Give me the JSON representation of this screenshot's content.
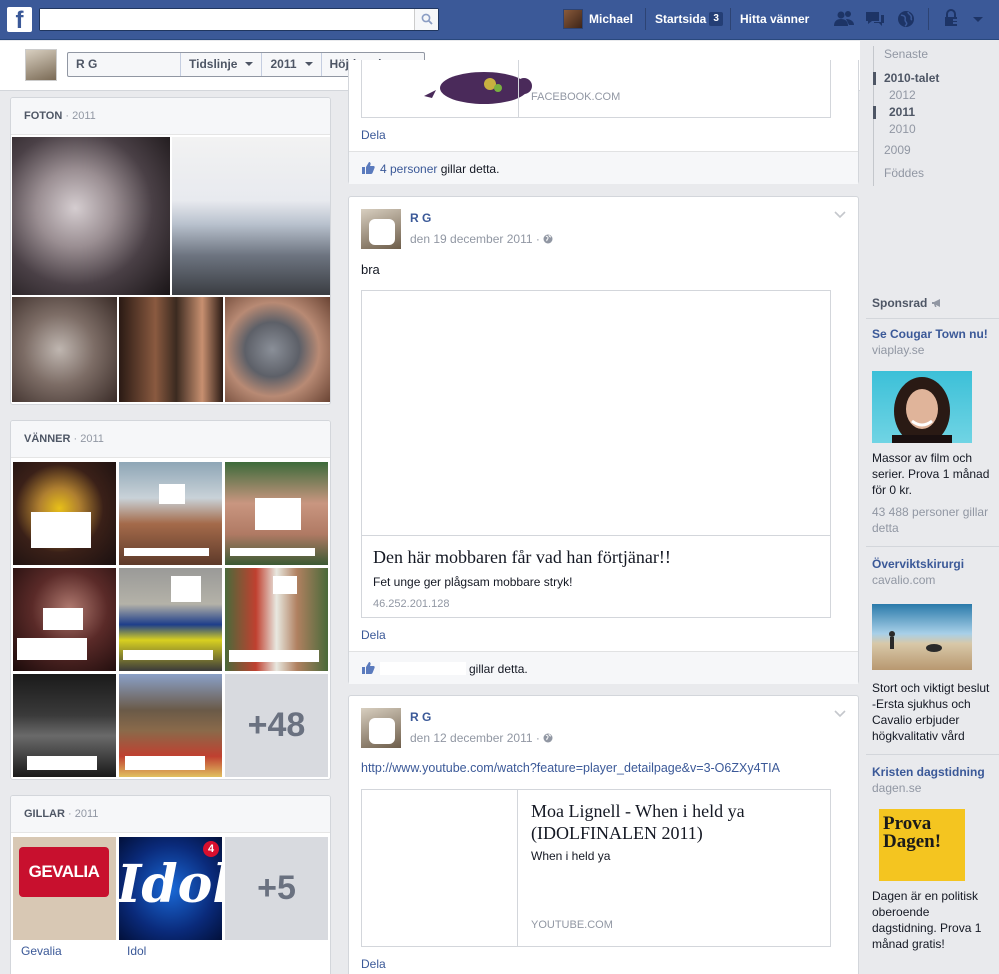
{
  "topbar": {
    "logo": "f",
    "search_placeholder": "",
    "user_name": "Michael",
    "home_label": "Startsida",
    "home_count": "3",
    "find_friends": "Hitta vänner"
  },
  "timeline_header": {
    "name": "R   G",
    "timeline_label": "Tidslinje",
    "year_label": "2011",
    "highlights_label": "Höjdpunkter"
  },
  "photos": {
    "title": "FOTON",
    "year": "2011"
  },
  "friends": {
    "title": "VÄNNER",
    "year": "2011",
    "more": "+48"
  },
  "likes": {
    "title": "GILLAR",
    "year": "2011",
    "more": "+5",
    "items": [
      {
        "label": "Gevalia",
        "logo_text": "GEVALIA"
      },
      {
        "label": "Idol",
        "logo_text": "Idol",
        "badge": "4"
      }
    ]
  },
  "posts": [
    {
      "attachment_source": "FACEBOOK.COM",
      "share_label": "Dela",
      "likes_count": "4 personer",
      "likes_suffix": "gillar detta."
    },
    {
      "author": "R   G",
      "date": "den 19 december 2011",
      "separator": "·",
      "text": "bra",
      "attachment_title": "Den här mobbaren får vad han förtjänar!!",
      "attachment_subtitle": "Fet unge ger plågsam mobbare stryk!",
      "attachment_source": "46.252.201.128",
      "share_label": "Dela",
      "likes_suffix": "gillar detta."
    },
    {
      "author": "R   G",
      "date": "den 12 december 2011",
      "separator": "·",
      "text": "http://www.youtube.com/watch?feature=player_detailpage&v=3-O6ZXy4TIA",
      "attachment_title": "Moa Lignell - When i held ya (IDOLFINALEN 2011)",
      "attachment_subtitle": "When i held ya",
      "attachment_source": "YOUTUBE.COM",
      "share_label": "Dela"
    }
  ],
  "scrubber": {
    "items": [
      "Senaste",
      "2010-talet",
      "2012",
      "2011",
      "2010",
      "2009",
      "Föddes"
    ],
    "active": "2011"
  },
  "ads": {
    "title": "Sponsrad",
    "items": [
      {
        "title": "Se Cougar Town nu!",
        "domain": "viaplay.se",
        "body": "Massor av film och serier. Prova 1 månad för 0 kr.",
        "likes": "43 488 personer gillar detta"
      },
      {
        "title": "Överviktskirurgi",
        "domain": "cavalio.com",
        "body": "Stort och viktigt beslut -Ersta sjukhus och Cavalio erbjuder högkvalitativ vård"
      },
      {
        "title": "Kristen dagstidning",
        "domain": "dagen.se",
        "image_text": "Prova Dagen!",
        "body": "Dagen är en politisk oberoende dagstidning. Prova 1 månad gratis!"
      }
    ]
  },
  "colors": {
    "brand": "#3b5998",
    "background": "#e9eaed",
    "link": "#3b5998",
    "muted": "#9197a3"
  }
}
